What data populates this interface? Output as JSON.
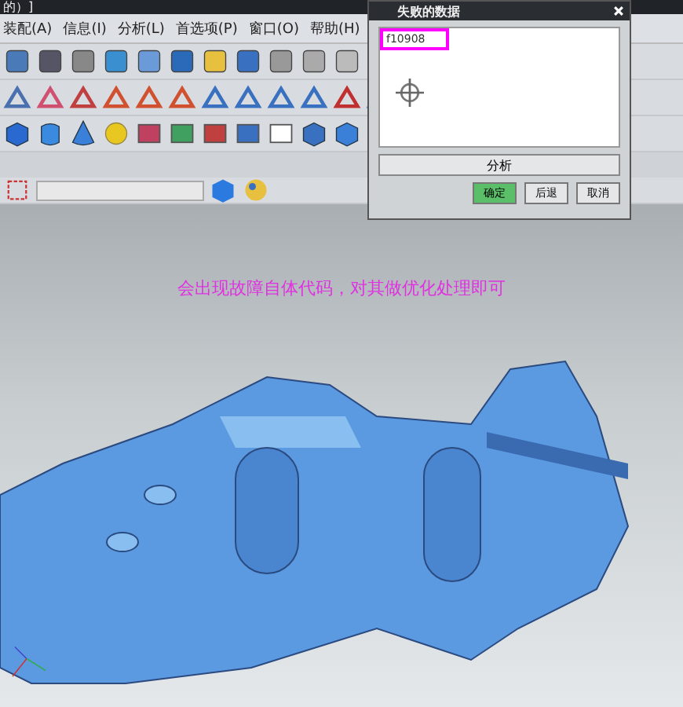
{
  "window": {
    "title": "的）]"
  },
  "menu": [
    {
      "label": "装配(A)"
    },
    {
      "label": "信息(I)"
    },
    {
      "label": "分析(L)"
    },
    {
      "label": "首选项(P)"
    },
    {
      "label": "窗口(O)"
    },
    {
      "label": "帮助(H)"
    }
  ],
  "dialog": {
    "title": "失败的数据",
    "list_items": [
      {
        "label": "f10908",
        "selected": true
      }
    ],
    "analyze_button": "分析",
    "buttons": [
      {
        "label": "确定",
        "kind": "primary"
      },
      {
        "label": "后退",
        "kind": "normal"
      },
      {
        "label": "取消",
        "kind": "normal"
      }
    ]
  },
  "caption": "会出现故障自体代码，对其做优化处理即可"
}
